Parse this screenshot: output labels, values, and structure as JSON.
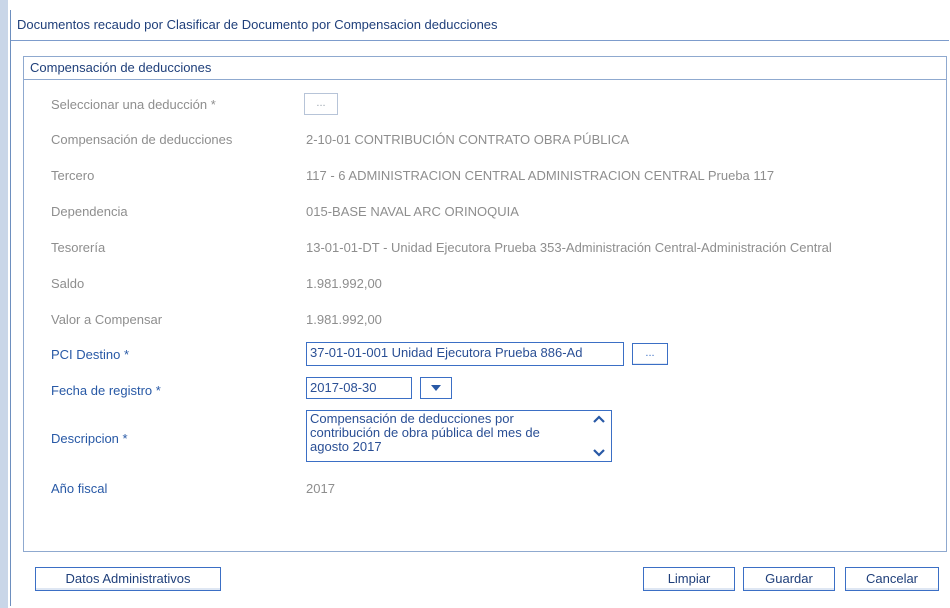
{
  "window": {
    "title": "Documentos recaudo por Clasificar de Documento por Compensacion deducciones"
  },
  "panel": {
    "title": "Compensación de deducciones"
  },
  "form": {
    "seleccionar": {
      "label": "Seleccionar una deducción *",
      "button": "..."
    },
    "compensacion": {
      "label": "Compensación de deducciones",
      "value": "2-10-01 CONTRIBUCIÓN CONTRATO OBRA PÚBLICA"
    },
    "tercero": {
      "label": "Tercero",
      "value": "117 - 6 ADMINISTRACION CENTRAL ADMINISTRACION CENTRAL Prueba 117"
    },
    "dependencia": {
      "label": "Dependencia",
      "value": "015-BASE NAVAL ARC ORINOQUIA"
    },
    "tesoreria": {
      "label": "Tesorería",
      "value": "13-01-01-DT - Unidad Ejecutora Prueba 353-Administración Central-Administración Central"
    },
    "saldo": {
      "label": "Saldo",
      "value": "1.981.992,00"
    },
    "valor": {
      "label": "Valor a Compensar",
      "value": "1.981.992,00"
    },
    "pci": {
      "label": "PCI Destino *",
      "value": "37-01-01-001 Unidad Ejecutora Prueba 886-Ad",
      "button": "..."
    },
    "fecha": {
      "label": "Fecha de registro *",
      "value": "2017-08-30"
    },
    "descripcion": {
      "label": "Descripcion *",
      "value": "Compensación de deducciones por contribución de obra pública del mes de agosto 2017"
    },
    "anio": {
      "label": "Año fiscal",
      "value": "2017"
    }
  },
  "buttons": {
    "datos": "Datos Administrativos",
    "limpiar": "Limpiar",
    "guardar": "Guardar",
    "cancelar": "Cancelar"
  },
  "colors": {
    "accent": "#3b6fc5",
    "label_required": "#2859a6",
    "label_muted": "#8e8e8e",
    "title": "#1f3f7a"
  },
  "icons": [
    "chevron-down-icon",
    "chevron-up-icon",
    "ellipsis-icon"
  ]
}
